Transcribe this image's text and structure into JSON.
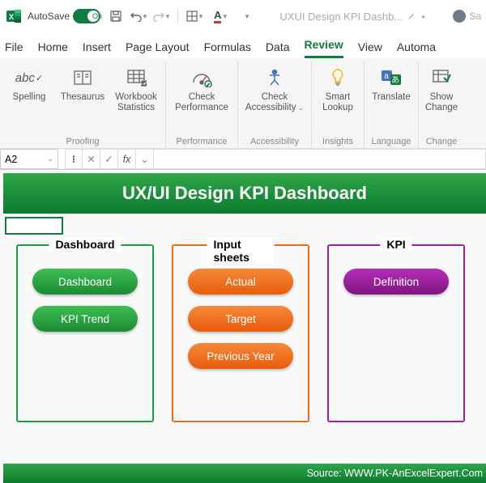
{
  "titlebar": {
    "autosave_label": "AutoSave",
    "autosave_state": "On",
    "doc_title": "UXUI Design KPI Dashb...",
    "user_label": "Sa"
  },
  "tabs": {
    "file": "File",
    "home": "Home",
    "insert": "Insert",
    "page_layout": "Page Layout",
    "formulas": "Formulas",
    "data": "Data",
    "review": "Review",
    "view": "View",
    "automate": "Automa"
  },
  "ribbon": {
    "proofing": {
      "label": "Proofing",
      "spelling": "Spelling",
      "thesaurus": "Thesaurus",
      "workbook_stats": "Workbook\nStatistics"
    },
    "performance": {
      "label": "Performance",
      "check_perf": "Check\nPerformance"
    },
    "accessibility": {
      "label": "Accessibility",
      "check_access": "Check\nAccessibility"
    },
    "insights": {
      "label": "Insights",
      "smart_lookup": "Smart\nLookup"
    },
    "language": {
      "label": "Language",
      "translate": "Translate"
    },
    "changes": {
      "label": "Change",
      "show_changes": "Show\nChange"
    }
  },
  "formula_bar": {
    "name_box": "A2",
    "fx": "fx"
  },
  "dashboard": {
    "title": "UX/UI Design KPI Dashboard",
    "panels": {
      "dashboard": {
        "title": "Dashboard",
        "btn1": "Dashboard",
        "btn2": "KPI Trend"
      },
      "input": {
        "title": "Input sheets",
        "btn1": "Actual",
        "btn2": "Target",
        "btn3": "Previous Year"
      },
      "kpi": {
        "title": "KPI",
        "btn1": "Definition"
      }
    },
    "footer": "Source: WWW.PK-AnExcelExpert.Com"
  }
}
